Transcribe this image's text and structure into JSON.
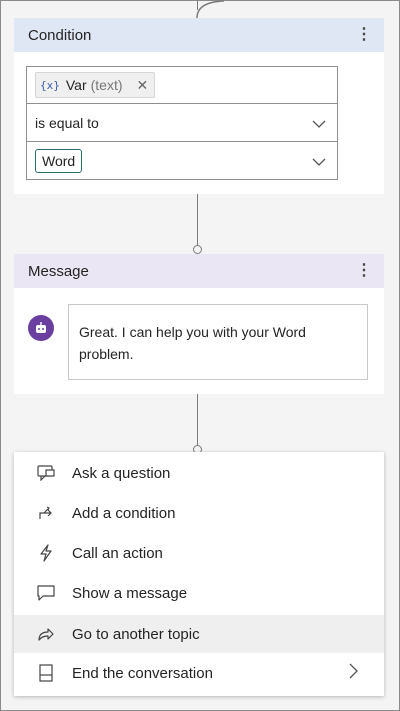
{
  "condition": {
    "title": "Condition",
    "variable": {
      "icon": "{x}",
      "name": "Var",
      "type": "(text)"
    },
    "operator": "is equal to",
    "value": "Word"
  },
  "message": {
    "title": "Message",
    "text_line1": "Great. I can help you with your Word",
    "text_line2": "problem."
  },
  "menu": {
    "items": [
      {
        "label": "Ask a question",
        "icon": "question-icon"
      },
      {
        "label": "Add a condition",
        "icon": "branch-icon"
      },
      {
        "label": "Call an action",
        "icon": "lightning-icon"
      },
      {
        "label": "Show a message",
        "icon": "chat-bubble-icon"
      },
      {
        "label": "Go to another topic",
        "icon": "redirect-arrow-icon",
        "highlighted": true
      },
      {
        "label": "End the conversation",
        "icon": "end-conversation-icon",
        "has_submenu": true
      }
    ]
  },
  "colors": {
    "condition_header": "#dfe6f4",
    "message_header": "#ebe6f4",
    "bot_avatar": "#6b3fa0",
    "hover": "#efefef"
  }
}
